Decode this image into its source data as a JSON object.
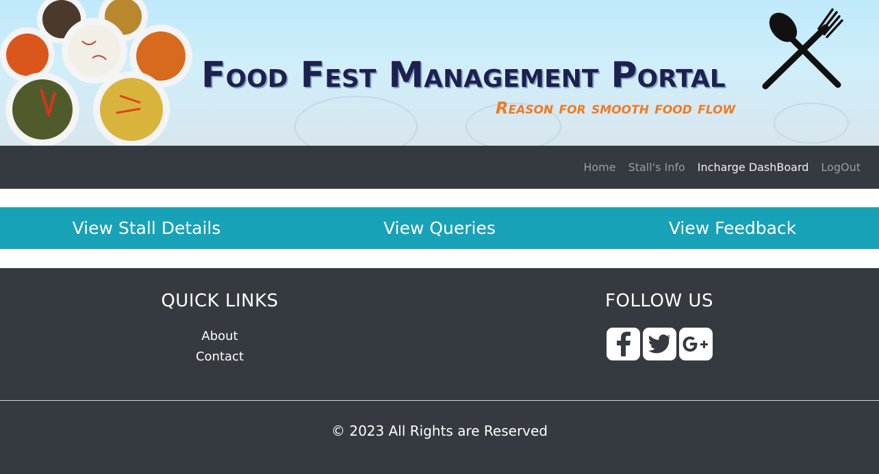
{
  "banner": {
    "title": "Food Fest Management Portal",
    "tagline": "Reason for smooth food flow",
    "colors": {
      "title": "#1c2150",
      "tagline": "#ee7b22"
    }
  },
  "nav": {
    "items": [
      {
        "label": "Home",
        "active": false
      },
      {
        "label": "Stall's Info",
        "active": false
      },
      {
        "label": "Incharge DashBoard",
        "active": true
      },
      {
        "label": "LogOut",
        "active": false
      }
    ]
  },
  "actions": [
    {
      "label": "View Stall Details"
    },
    {
      "label": "View Queries"
    },
    {
      "label": "View Feedback"
    }
  ],
  "footer": {
    "quick_links_title": "QUICK LINKS",
    "quick_links": [
      {
        "label": "About"
      },
      {
        "label": "Contact"
      }
    ],
    "follow_title": "FOLLOW US",
    "social": [
      {
        "icon": "facebook-icon"
      },
      {
        "icon": "twitter-icon"
      },
      {
        "icon": "google-plus-icon"
      }
    ],
    "copyright": "© 2023 All Rights are Reserved"
  },
  "colors": {
    "navbar": "#343a40",
    "action_bar": "#17a2b8",
    "footer": "#343a40"
  }
}
